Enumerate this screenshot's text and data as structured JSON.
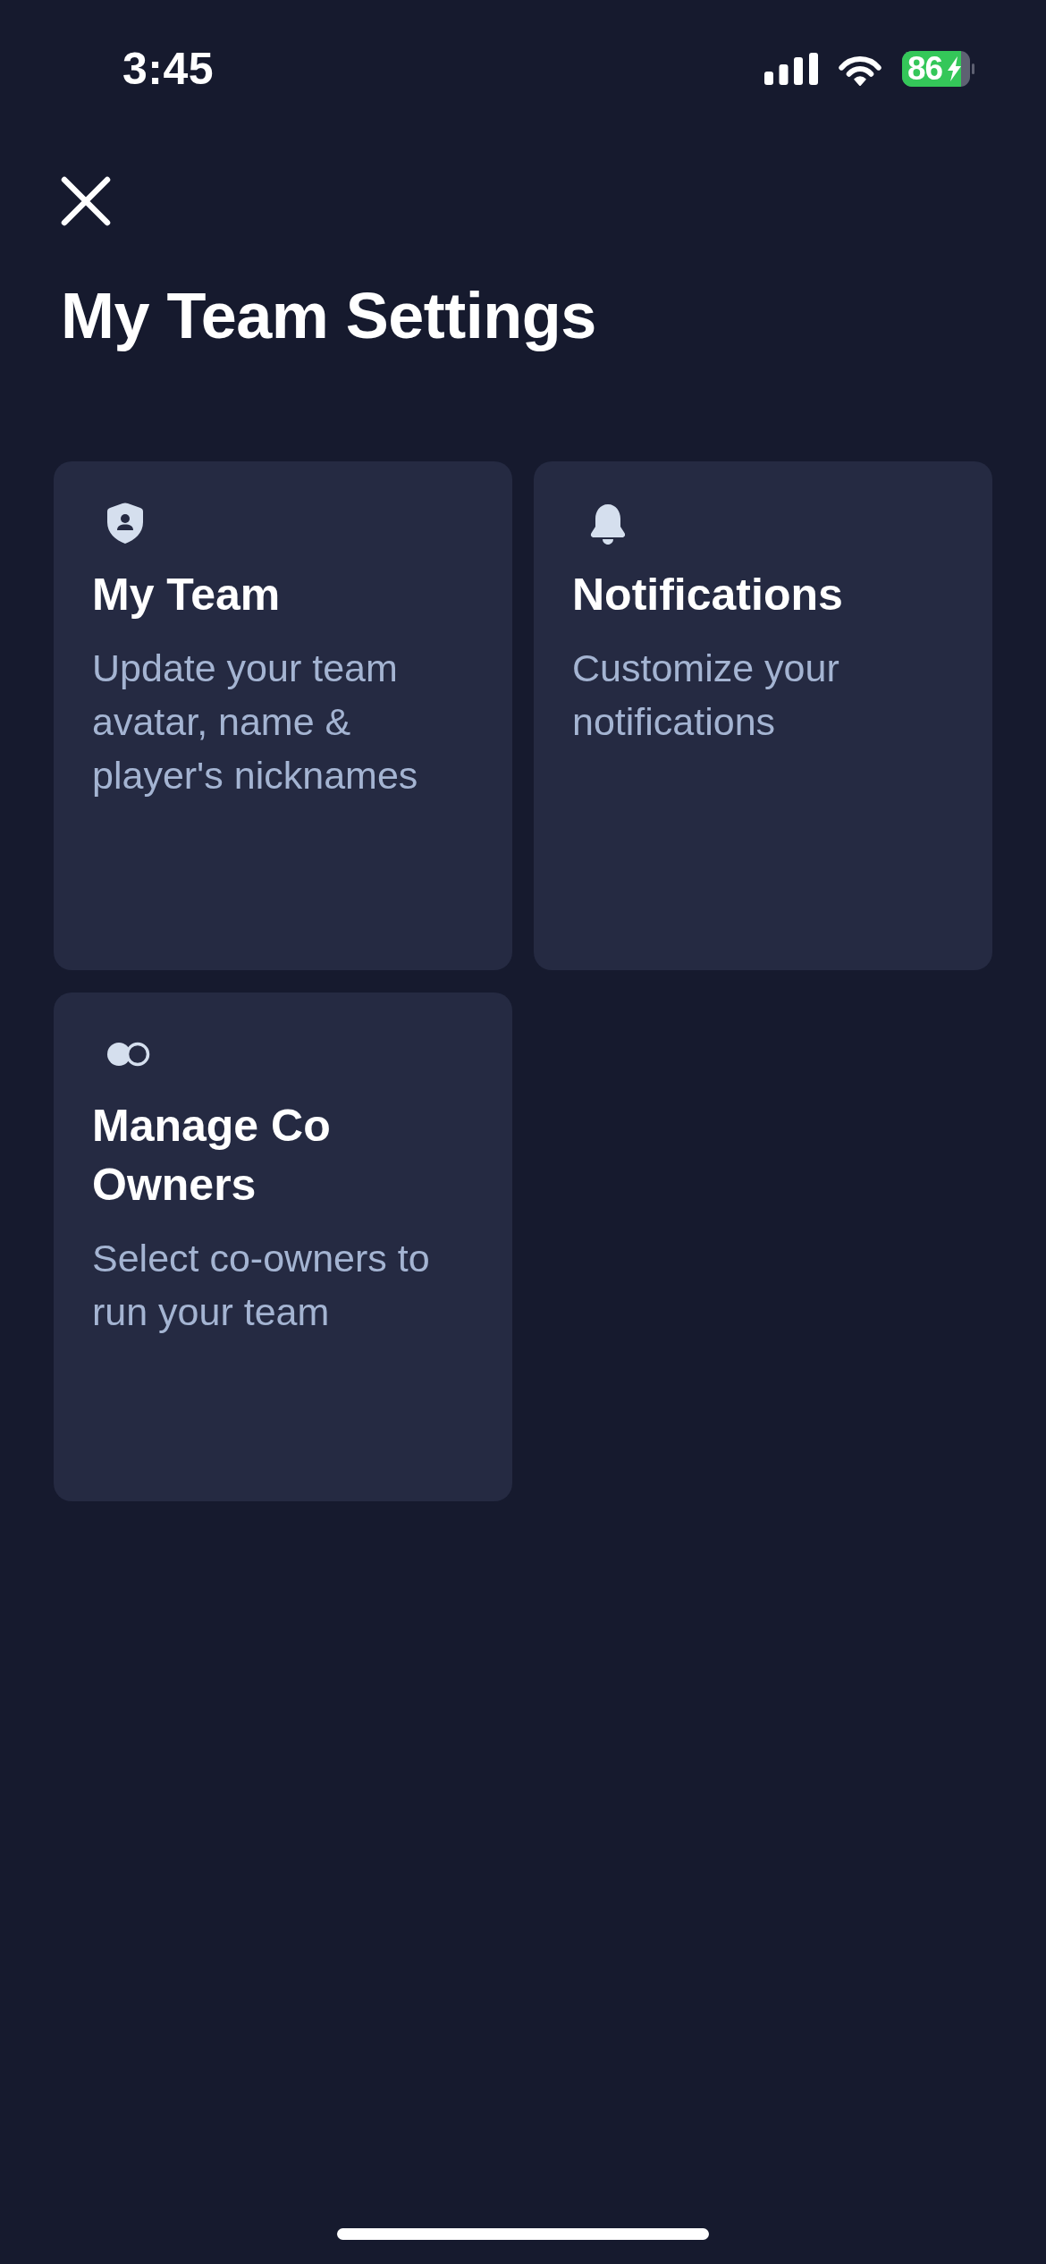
{
  "status_bar": {
    "time": "3:45",
    "battery_percent": "86"
  },
  "title": "My Team Settings",
  "cards": [
    {
      "kind": "team",
      "title": "My Team",
      "description": "Update your team avatar, name & player's nicknames"
    },
    {
      "kind": "notifications",
      "title": "Notifications",
      "description": "Customize your notifications"
    },
    {
      "kind": "co_owners",
      "title": "Manage Co Owners",
      "description": "Select co-owners to run your team"
    }
  ]
}
